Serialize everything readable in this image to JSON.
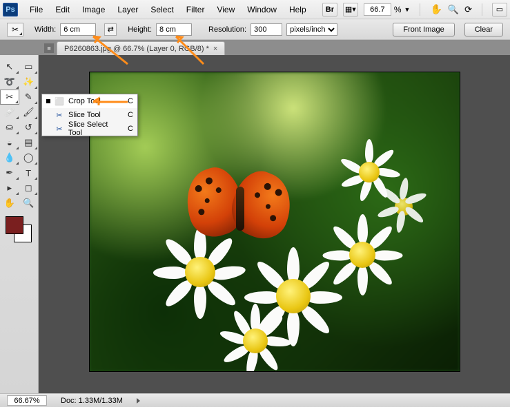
{
  "menubar": {
    "items": [
      "File",
      "Edit",
      "Image",
      "Layer",
      "Select",
      "Filter",
      "View",
      "Window",
      "Help"
    ],
    "zoom": "66.7"
  },
  "optbar": {
    "width_label": "Width:",
    "width_value": "6 cm",
    "height_label": "Height:",
    "height_value": "8 cm",
    "res_label": "Resolution:",
    "res_value": "300",
    "unit": "pixels/inch",
    "front_btn": "Front Image",
    "clear_btn": "Clear"
  },
  "tab": {
    "title": "P6260863.jpg @ 66.7% (Layer 0, RGB/8) *"
  },
  "flyout": {
    "items": [
      {
        "label": "Crop Tool",
        "key": "C",
        "active": true
      },
      {
        "label": "Slice Tool",
        "key": "C",
        "active": false
      },
      {
        "label": "Slice Select Tool",
        "key": "C",
        "active": false
      }
    ]
  },
  "status": {
    "zoom": "66.67%",
    "doc": "Doc: 1.33M/1.33M"
  },
  "colors": {
    "foreground": "#7a1f1f",
    "background": "#ffffff"
  }
}
